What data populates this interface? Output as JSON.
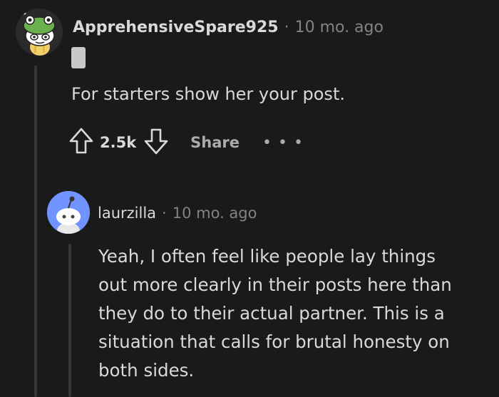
{
  "comments": [
    {
      "username": "ApprehensiveSpare925",
      "time": "10 mo. ago",
      "body": "For starters show her your post.",
      "actions": {
        "upvote_count": "2.5k",
        "share_label": "Share",
        "more_label": "• • •"
      }
    },
    {
      "username": "laurzilla",
      "time": "10 mo. ago",
      "body_lines": [
        "Yeah, I often feel like people lay things",
        "out more clearly in their posts here than",
        "they do to their actual partner. This is a",
        "situation that calls for brutal honesty on",
        "both sides."
      ]
    }
  ],
  "separator": "·",
  "colors": {
    "background": "#1a1a1b",
    "text": "#d7dadc",
    "muted": "#818384",
    "thread_line": "#343536",
    "flair": "#c8c8c8",
    "reply_avatar_bg": "#7193ff"
  },
  "icons": {
    "comment_1_avatar": "snoo-frog-hat-avatar",
    "comment_2_avatar": "default-snoo-avatar",
    "upvote": "upvote-arrow-icon",
    "downvote": "downvote-arrow-icon"
  }
}
